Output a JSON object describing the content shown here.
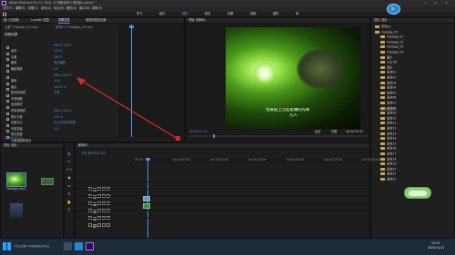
{
  "title": {
    "text": "Adobe Premiere Pro CC 2018 - E:\\视频\\制作工程\\图片.prproj *"
  },
  "menu": {
    "items": [
      "文件(F)",
      "编辑(E)",
      "剪辑(C)",
      "序列(S)",
      "标记(M)",
      "图形(G)",
      "窗口(W)",
      "帮助(H)"
    ]
  },
  "workspaces": {
    "items": [
      "学习",
      "组件",
      "编辑",
      "颜色",
      "效果",
      "音频",
      "图形",
      "库"
    ]
  },
  "effect_controls": {
    "tabs": [
      "源: (无剪辑)",
      "Lumetri 范围",
      "效果控件",
      "音频剪辑混合器"
    ],
    "source_label": "主要 * Footage_05.mp4",
    "clip_label": "序列01 * Footage_05.mp4",
    "section_title": "视频效果",
    "rows": [
      {
        "label": "运动",
        "value": ""
      },
      {
        "label": "位置",
        "value": "360.0  240.0"
      },
      {
        "label": "缩放",
        "value": "100.0"
      },
      {
        "label": "缩放宽度",
        "value": "100.0"
      },
      {
        "label": "",
        "value": "等比缩放"
      },
      {
        "label": "旋转",
        "value": "0.0"
      },
      {
        "label": "锚点",
        "value": "360.0  240.0"
      },
      {
        "label": "防闪烁滤镜",
        "value": "0.00"
      },
      {
        "label": "不透明度",
        "value": "100.0 %"
      },
      {
        "label": "混合模式",
        "value": "正常"
      },
      {
        "label": "时间重映射",
        "value": ""
      },
      {
        "label": "镜头光晕",
        "value": ""
      },
      {
        "label": "光晕中心",
        "value": "360.0  240.0"
      },
      {
        "label": "光晕亮度",
        "value": "100 %"
      },
      {
        "label": "镜头类型",
        "value": "50-300毫米变焦"
      },
      {
        "label": "与原始图像混合",
        "value": "0 %"
      }
    ],
    "timecode": "00:00:03:14"
  },
  "program": {
    "tab": "节目: 序列01",
    "subtitle_line1": "金属般上泛起斑斓的光晕",
    "subtitle_line2": "凡人",
    "timecode_left": "00:00:03:14",
    "fit": "适合",
    "quality": "完整",
    "timecode_right": "00:00:05:22"
  },
  "project": {
    "tab": "项目: 图片",
    "items": [
      "序列01",
      "Footage_05",
      "Footage_01",
      "Footage_02",
      "Footage_03",
      "Footage_04",
      "图片",
      "Clip 06",
      "音乐",
      "素材01",
      "素材02",
      "素材03",
      "素材04",
      "素材05",
      "素材06",
      "素材07",
      "素材08",
      "素材09",
      "素材10",
      "素材11",
      "素材12",
      "素材13",
      "素材14",
      "素材15",
      "素材16",
      "素材17",
      "素材18",
      "素材19",
      "素材20",
      "素材21",
      "素材22"
    ]
  },
  "media": {
    "tab": "项目: 图片",
    "clip_name": "Footage.mp4"
  },
  "timeline": {
    "tab": "序列01",
    "timecode": "00:00:03:14",
    "ruler": [
      "00:00",
      "00:00:05:00",
      "00:00:10:00",
      "00:00:15:00",
      "00:00:20:00",
      "00:00:25:00",
      "00:00:30:00"
    ],
    "tracks": [
      "V3",
      "V2",
      "V1",
      "A1",
      "A2",
      "A3"
    ]
  },
  "taskbar": {
    "search_placeholder": "在这里输入你要搜索的内容",
    "time": "15:25",
    "date": "2020/11/17"
  },
  "colors": {
    "accent_blue": "#4d8fe0",
    "arrow_red": "#d42a2a",
    "playhead": "#4d8fe0",
    "clip_teal": "#5aa7b5"
  }
}
